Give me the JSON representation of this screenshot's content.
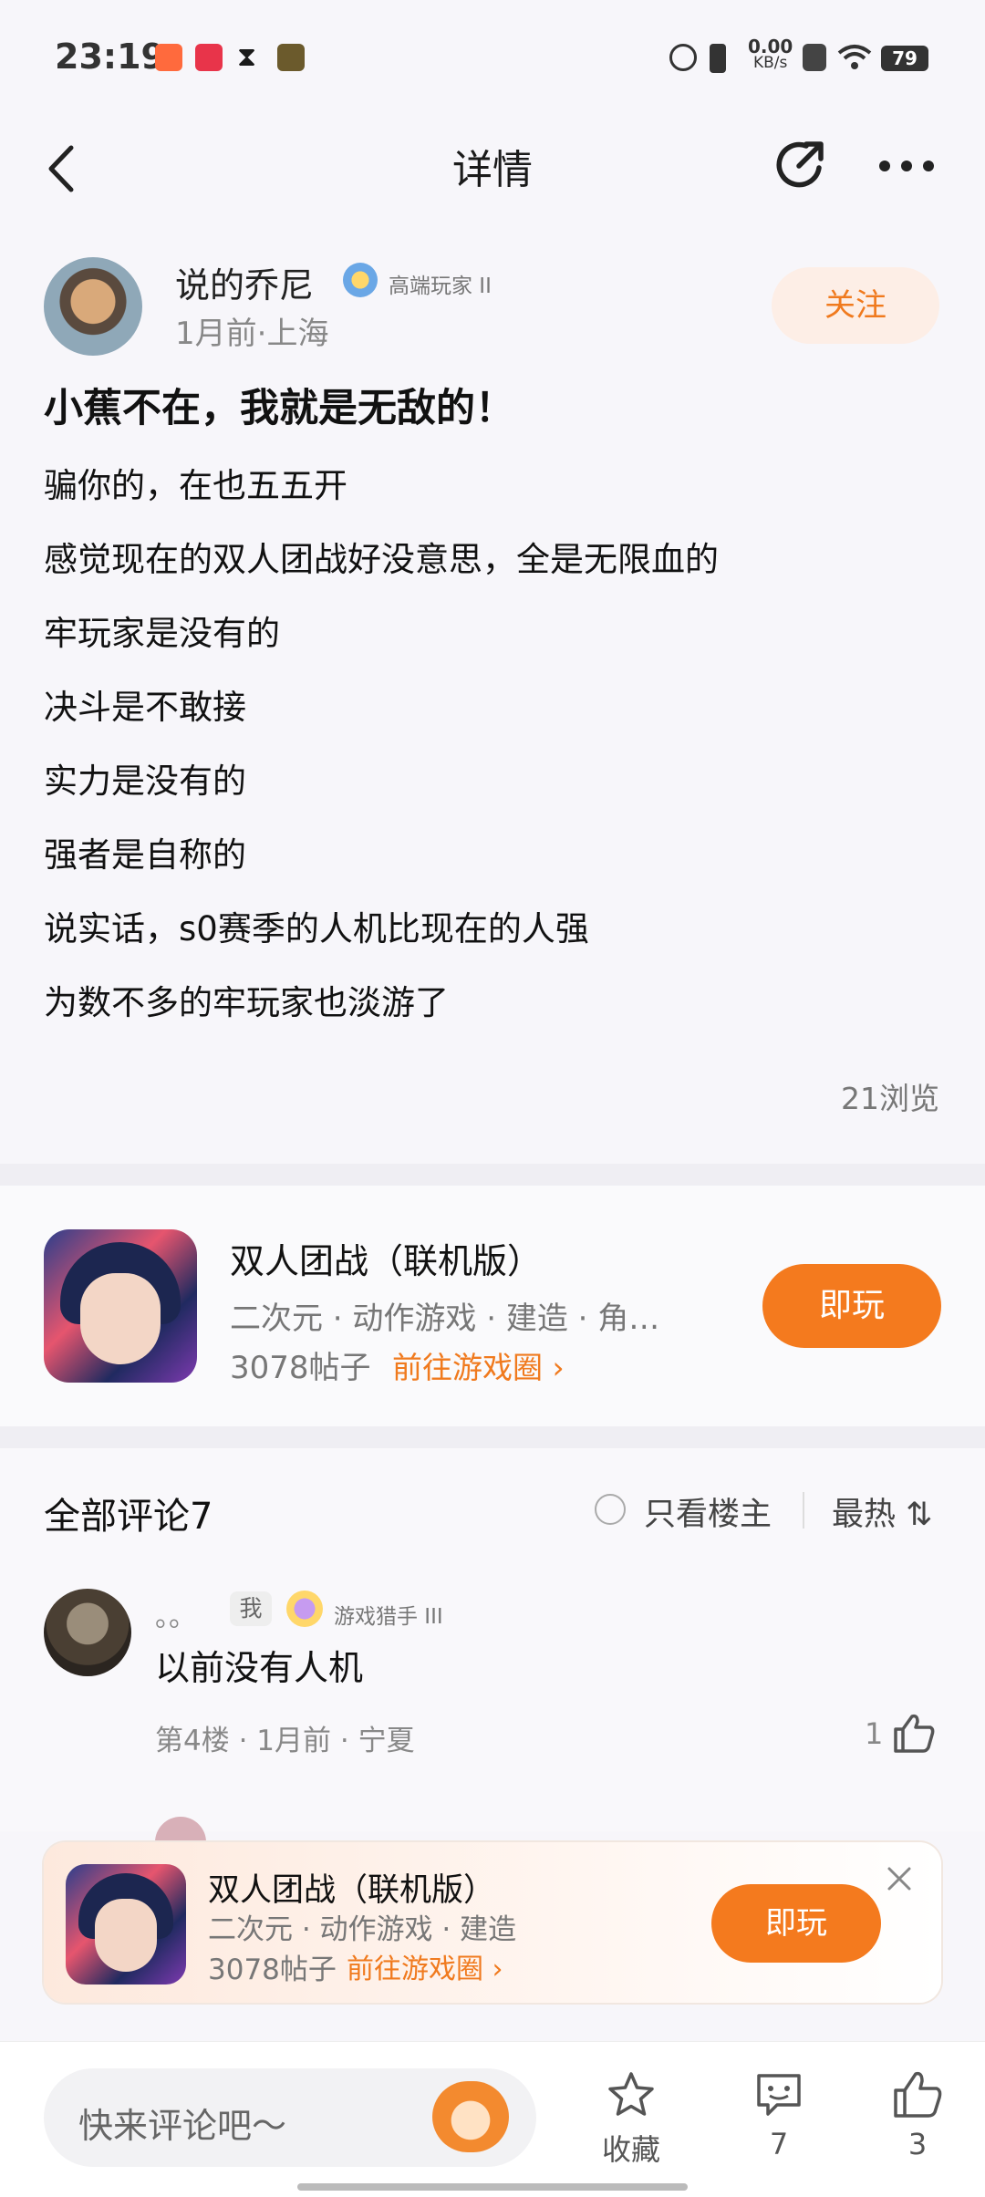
{
  "status_bar": {
    "time": "23:19",
    "net_speed_value": "0.00",
    "net_speed_unit": "KB/s",
    "battery": "79"
  },
  "nav": {
    "title": "详情",
    "back_icon": "chevron-left-icon",
    "share_icon": "share-icon",
    "more_icon": "more-icon"
  },
  "post": {
    "author": "说的乔尼",
    "badge": "高端玩家 II",
    "meta": "1月前·上海",
    "follow_label": "关注",
    "title": "小蕉不在，我就是无敌的！",
    "lines": [
      "骗你的，在也五五开",
      "感觉现在的双人团战好没意思，全是无限血的",
      "牢玩家是没有的",
      "决斗是不敢接",
      "实力是没有的",
      "强者是自称的",
      "说实话，s0赛季的人机比现在的人强",
      "为数不多的牢玩家也淡游了"
    ],
    "views": "21浏览"
  },
  "game_card": {
    "name": "双人团战（联机版）",
    "tags": "二次元 · 动作游戏 · 建造 · 角…",
    "posts": "3078帖子",
    "link": "前往游戏圈 ›",
    "play_label": "即玩"
  },
  "comments": {
    "header": "全部评论7",
    "only_host": "只看楼主",
    "sort": "最热 ⇅",
    "items": [
      {
        "name": "。。",
        "me_tag": "我",
        "badge": "游戏猎手 III",
        "text": "以前没有人机",
        "meta": "第4楼 · 1月前 · 宁夏",
        "likes": "1"
      }
    ]
  },
  "banner": {
    "name": "双人团战（联机版）",
    "tags": "二次元 · 动作游戏 · 建造",
    "posts": "3078帖子",
    "link": "前往游戏圈 ›",
    "play_label": "即玩"
  },
  "bottom_bar": {
    "comment_placeholder": "快来评论吧～",
    "favorite_label": "收藏",
    "comment_count": "7",
    "like_count": "3"
  },
  "colors": {
    "accent": "#f47a1e",
    "background": "#f7f6fa"
  }
}
